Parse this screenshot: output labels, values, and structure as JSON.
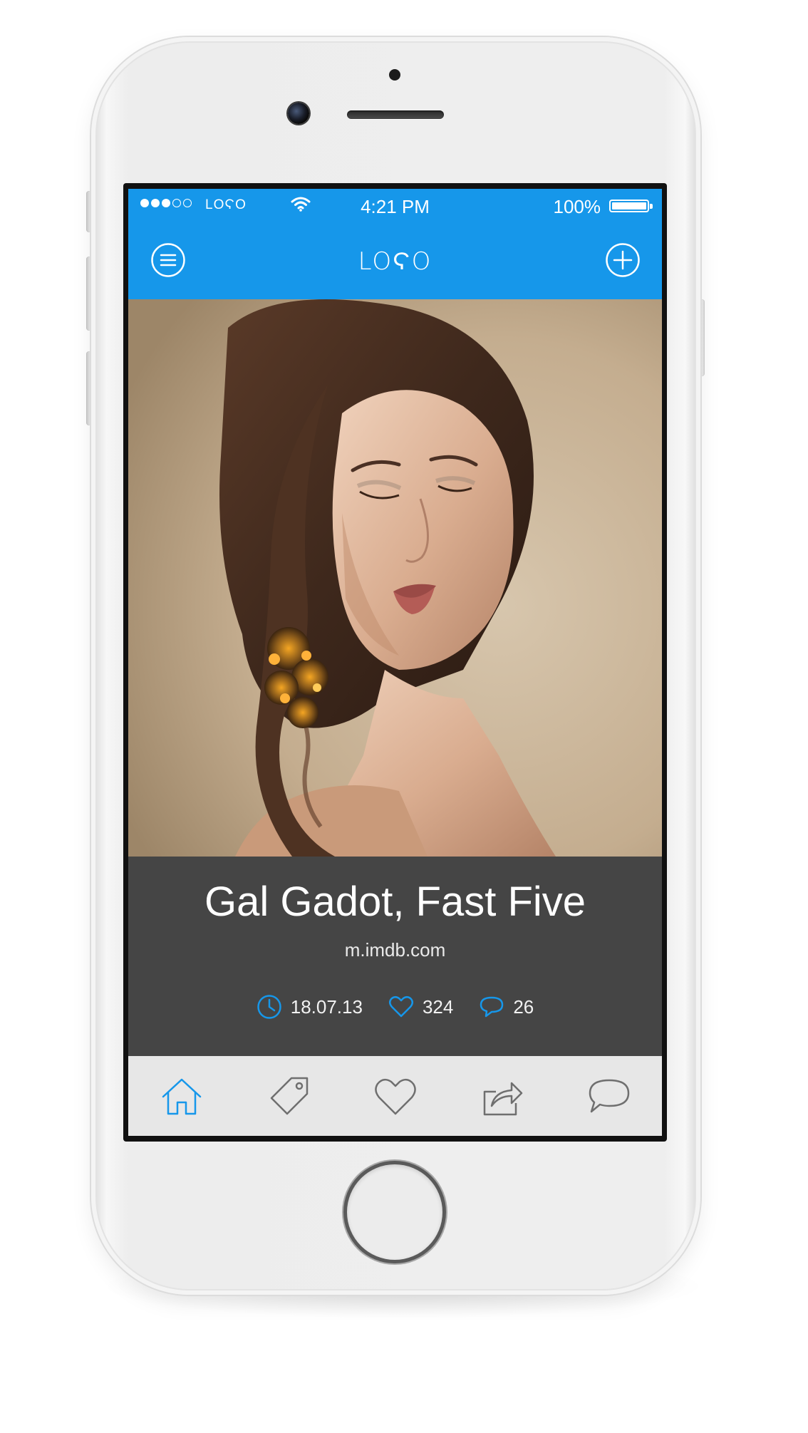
{
  "status_bar": {
    "signal_bars": 5,
    "signal_filled": 3,
    "carrier": "LOϚO",
    "time": "4:21 PM",
    "battery_percent": "100%",
    "battery_level": 1.0
  },
  "nav": {
    "logo": "LOϚO",
    "menu_icon": "menu-circle-icon",
    "add_icon": "plus-circle-icon"
  },
  "hero": {
    "subject": "portrait photo"
  },
  "card": {
    "title": "Gal Gadot, Fast Five",
    "source": "m.imdb.com",
    "date": "18.07.13",
    "likes": "324",
    "comments": "26"
  },
  "tabbar": {
    "tabs": [
      {
        "name": "home",
        "icon": "home-icon",
        "active": true
      },
      {
        "name": "tags",
        "icon": "tag-icon",
        "active": false
      },
      {
        "name": "favorites",
        "icon": "heart-icon",
        "active": false
      },
      {
        "name": "share",
        "icon": "share-icon",
        "active": false
      },
      {
        "name": "messages",
        "icon": "chat-icon",
        "active": false
      }
    ]
  },
  "colors": {
    "accent": "#1697ea",
    "card_bg": "#454545",
    "tabbar_bg": "#e7e7e7",
    "icon_inactive": "#6f6f6f"
  }
}
